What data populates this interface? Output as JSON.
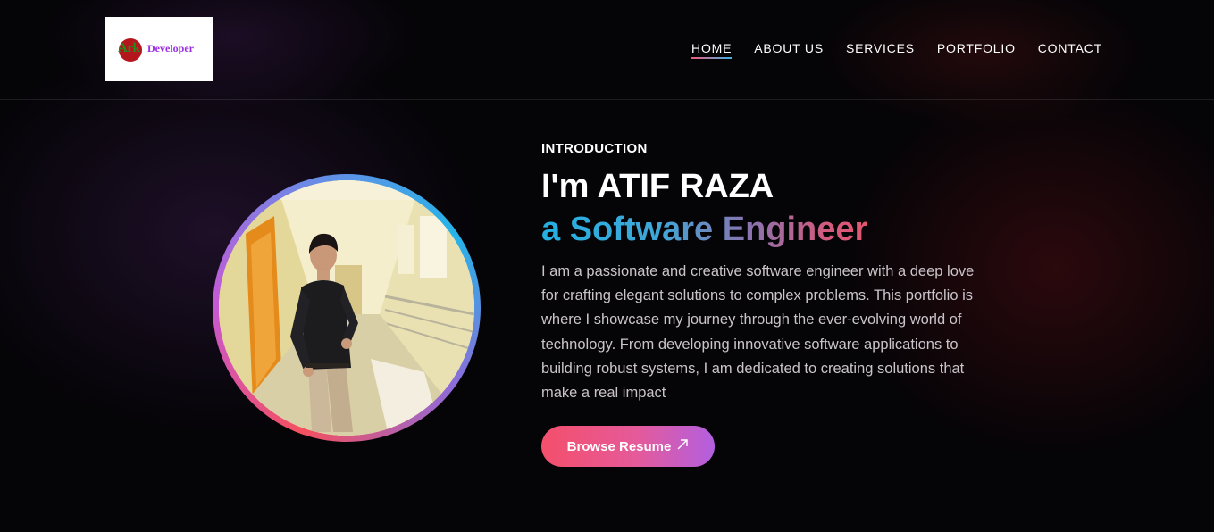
{
  "logo": {
    "mark": "Ark",
    "word": "Developer"
  },
  "nav": {
    "items": [
      {
        "label": "HOME",
        "active": true
      },
      {
        "label": "ABOUT US",
        "active": false
      },
      {
        "label": "SERVICES",
        "active": false
      },
      {
        "label": "PORTFOLIO",
        "active": false
      },
      {
        "label": "CONTACT",
        "active": false
      }
    ]
  },
  "hero": {
    "eyebrow": "INTRODUCTION",
    "name": "I'm ATIF RAZA",
    "role": "a Software Engineer",
    "description": "I am a passionate and creative software engineer with a deep love for crafting elegant solutions to complex problems. This portfolio is where I showcase my journey through the ever-evolving world of technology. From developing innovative software applications to building robust systems, I am dedicated to creating solutions that make a real impact",
    "button_label": "Browse Resume",
    "button_icon": "arrow-up-right-icon"
  },
  "colors": {
    "background": "#050407",
    "accent_pink": "#f44f6b",
    "accent_purple": "#b25fe0",
    "accent_blue": "#24b0e0"
  }
}
